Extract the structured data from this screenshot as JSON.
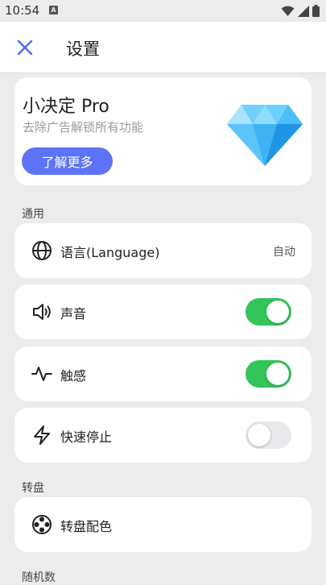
{
  "status_bar": {
    "time": "10:54",
    "notification_badge": "A"
  },
  "app_bar": {
    "title": "设置"
  },
  "pro": {
    "title": "小决定 Pro",
    "subtitle": "去除广告解锁所有功能",
    "button_label": "了解更多"
  },
  "sections": {
    "general": "通用",
    "wheel": "转盘",
    "random": "随机数"
  },
  "settings": {
    "language": {
      "label": "语言(Language)",
      "value": "自动",
      "icon": "globe-icon"
    },
    "sound": {
      "label": "声音",
      "enabled": true,
      "icon": "speaker-icon"
    },
    "haptics": {
      "label": "触感",
      "enabled": true,
      "icon": "pulse-icon"
    },
    "quick_stop": {
      "label": "快速停止",
      "enabled": false,
      "icon": "lightning-icon"
    },
    "wheel_color": {
      "label": "转盘配色",
      "icon": "palette-icon"
    }
  },
  "colors": {
    "accent": "#5d74f6",
    "toggle_on": "#33c45a",
    "close_icon": "#4a6cf0"
  }
}
